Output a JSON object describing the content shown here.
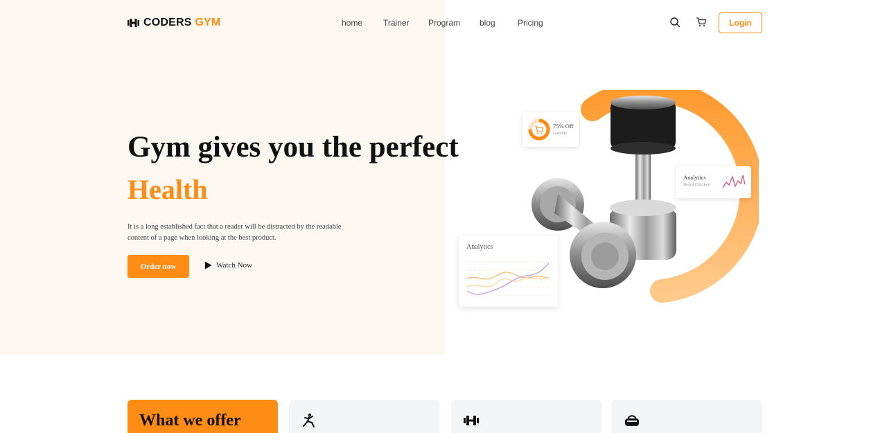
{
  "header": {
    "logo": {
      "main": "CODERS",
      "accent": "GYM",
      "icon": "dumbbell-icon"
    },
    "nav": [
      "home",
      "Trainer",
      "Program",
      "blog",
      "Pricing"
    ],
    "icons": [
      "search-icon",
      "cart-icon"
    ],
    "login_label": "Login"
  },
  "hero": {
    "title": "Gym gives you the perfect",
    "accent": "Health",
    "description": "It is a long established fact that a reader will be distracted by the readable content of a page when looking at the best product.",
    "order_label": "Order now",
    "watch_label": "Watch Now"
  },
  "illustration": {
    "discount_card": {
      "title": "75% Off",
      "subtitle": "Gamble",
      "progress": 0.75
    },
    "analytics_small": {
      "title": "Analytics",
      "subtitle": "Beard Chicken"
    },
    "analytics_large": {
      "title": "Analytics"
    }
  },
  "offer": {
    "title": "What we offer",
    "cards": [
      {
        "icon": "stretching-person-icon"
      },
      {
        "icon": "dumbbell-icon"
      },
      {
        "icon": "gym-bag-icon"
      }
    ]
  },
  "colors": {
    "accent": "#ff8c14",
    "hero_bg": "#fdf7f2",
    "card_bg": "#f3f4f6"
  }
}
